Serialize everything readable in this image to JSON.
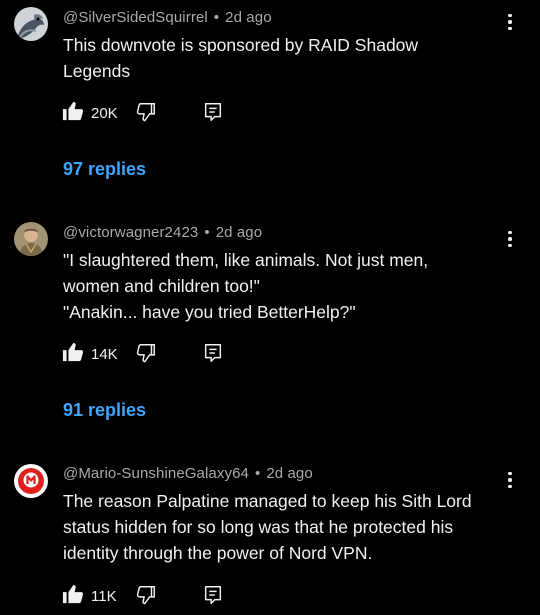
{
  "comments": [
    {
      "author": "@SilverSidedSquirrel",
      "time": "2d ago",
      "lines": [
        "This downvote is sponsored by RAID Shadow",
        "Legends"
      ],
      "likes": "20K",
      "replies": "97 replies"
    },
    {
      "author": "@victorwagner2423",
      "time": "2d ago",
      "lines": [
        "\"I slaughtered them, like animals. Not just men,",
        "women and children too!\"",
        "\"Anakin... have you tried BetterHelp?\""
      ],
      "likes": "14K",
      "replies": "91 replies"
    },
    {
      "author": "@Mario-SunshineGalaxy64",
      "time": "2d ago",
      "lines": [
        "The reason Palpatine managed to keep his Sith Lord",
        "status hidden for so long was that he protected his",
        "identity through the power of Nord VPN."
      ],
      "likes": "11K",
      "replies": ""
    }
  ],
  "separator": "•",
  "icons": {
    "like": "thumb-up-icon",
    "dislike": "thumb-down-icon",
    "reply": "comment-icon",
    "more": "more-vert-icon"
  },
  "colors": {
    "background": "#000000",
    "text": "#f1f1f1",
    "meta": "#aaaaaa",
    "link": "#3ea6ff"
  }
}
